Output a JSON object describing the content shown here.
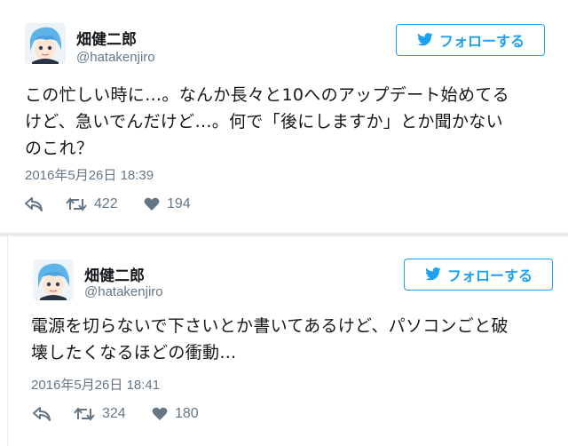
{
  "colors": {
    "accent": "#1da1f2",
    "text": "#14171a",
    "muted": "#657786",
    "border": "#e6ecf0"
  },
  "tweets": [
    {
      "author": {
        "display_name": "畑健二郎",
        "handle": "@hatakenjiro",
        "avatar_icon": "anime-avatar-icon"
      },
      "follow_label": "フォローする",
      "text_lines": [
        "この忙しい時に…。なんか長々と10へのアップデート始めてる",
        "けど、急いでんだけど…。何で「後にしますか」とか聞かない",
        "のこれ？"
      ],
      "timestamp": "2016年5月26日 18:39",
      "retweets": "422",
      "likes": "194"
    },
    {
      "author": {
        "display_name": "畑健二郎",
        "handle": "@hatakenjiro",
        "avatar_icon": "anime-avatar-icon"
      },
      "follow_label": "フォローする",
      "text_lines": [
        "電源を切らないで下さいとか書いてあるけど、パソコンごと破",
        "壊したくなるほどの衝動…"
      ],
      "timestamp": "2016年5月26日 18:41",
      "retweets": "324",
      "likes": "180"
    }
  ]
}
